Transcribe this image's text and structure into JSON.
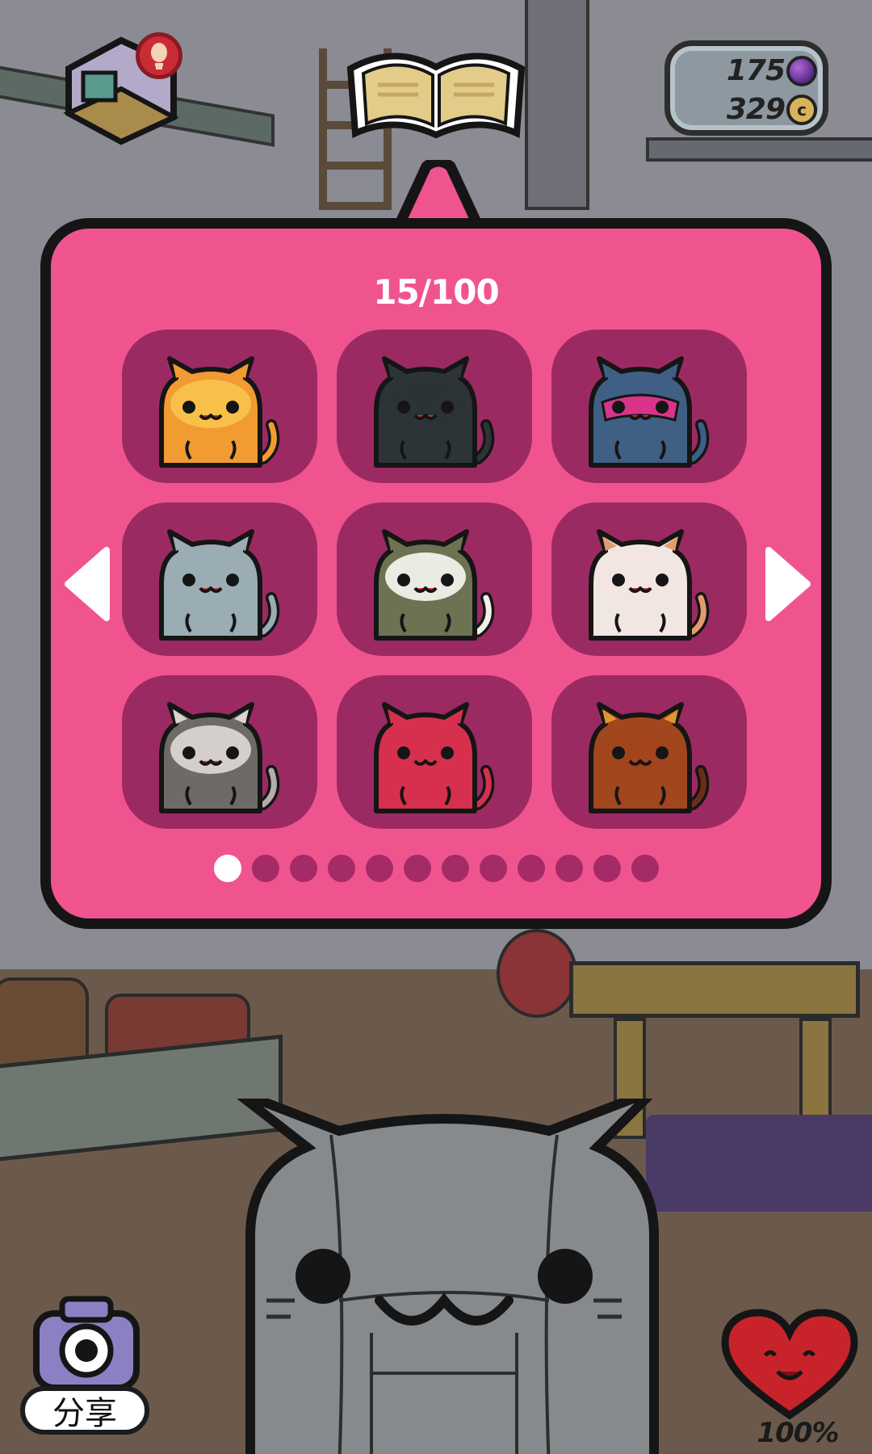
{
  "collection": {
    "counter": "15/100",
    "cats": [
      {
        "name": "Orange cat",
        "body": "#f29b33",
        "face": "#f8c24a",
        "ear": "#f29b33",
        "tail": "#f29b33"
      },
      {
        "name": "Black cat",
        "body": "#2c3437",
        "face": "#2c3437",
        "ear": "#2c3437",
        "tail": "#2c3437"
      },
      {
        "name": "Masked blue cat",
        "body": "#3f5f85",
        "face": "#3f5f85",
        "ear": "#3f5f85",
        "tail": "#3f5f85",
        "mask": "#d9338a"
      },
      {
        "name": "Robot cat",
        "body": "#9aacb4",
        "face": "#9aacb4",
        "ear": "#9aacb4",
        "tail": "#9aacb4"
      },
      {
        "name": "Olive and white cat",
        "body": "#6d7352",
        "face": "#f1f1ea",
        "ear": "#6d7352",
        "tail": "#f1f1ea"
      },
      {
        "name": "Calico cat",
        "body": "#f2e6e2",
        "face": "#f2e6e2",
        "ear": "#e49b6b",
        "tail": "#e49b6b"
      },
      {
        "name": "Grey and white cat",
        "body": "#6e6b67",
        "face": "#d9d5d2",
        "ear": "#d9d5d2",
        "tail": "#b3aeaa"
      },
      {
        "name": "Red cat",
        "body": "#d6304e",
        "face": "#d6304e",
        "ear": "#d6304e",
        "tail": "#d6304e"
      },
      {
        "name": "Brown cat",
        "body": "#a2461d",
        "face": "#a2461d",
        "ear": "#e1952e",
        "tail": "#6a2e14"
      }
    ],
    "page_dots": 12,
    "current_page": 1
  },
  "currency": {
    "gems": "175",
    "coins": "329",
    "coin_symbol": "c"
  },
  "share": {
    "label": "分享"
  },
  "happiness": {
    "value": "100%"
  },
  "colors": {
    "popup": "#f0548f",
    "cell": "#9c2a62",
    "dot_active": "#ffffff",
    "dot_inactive": "#a52b67"
  }
}
